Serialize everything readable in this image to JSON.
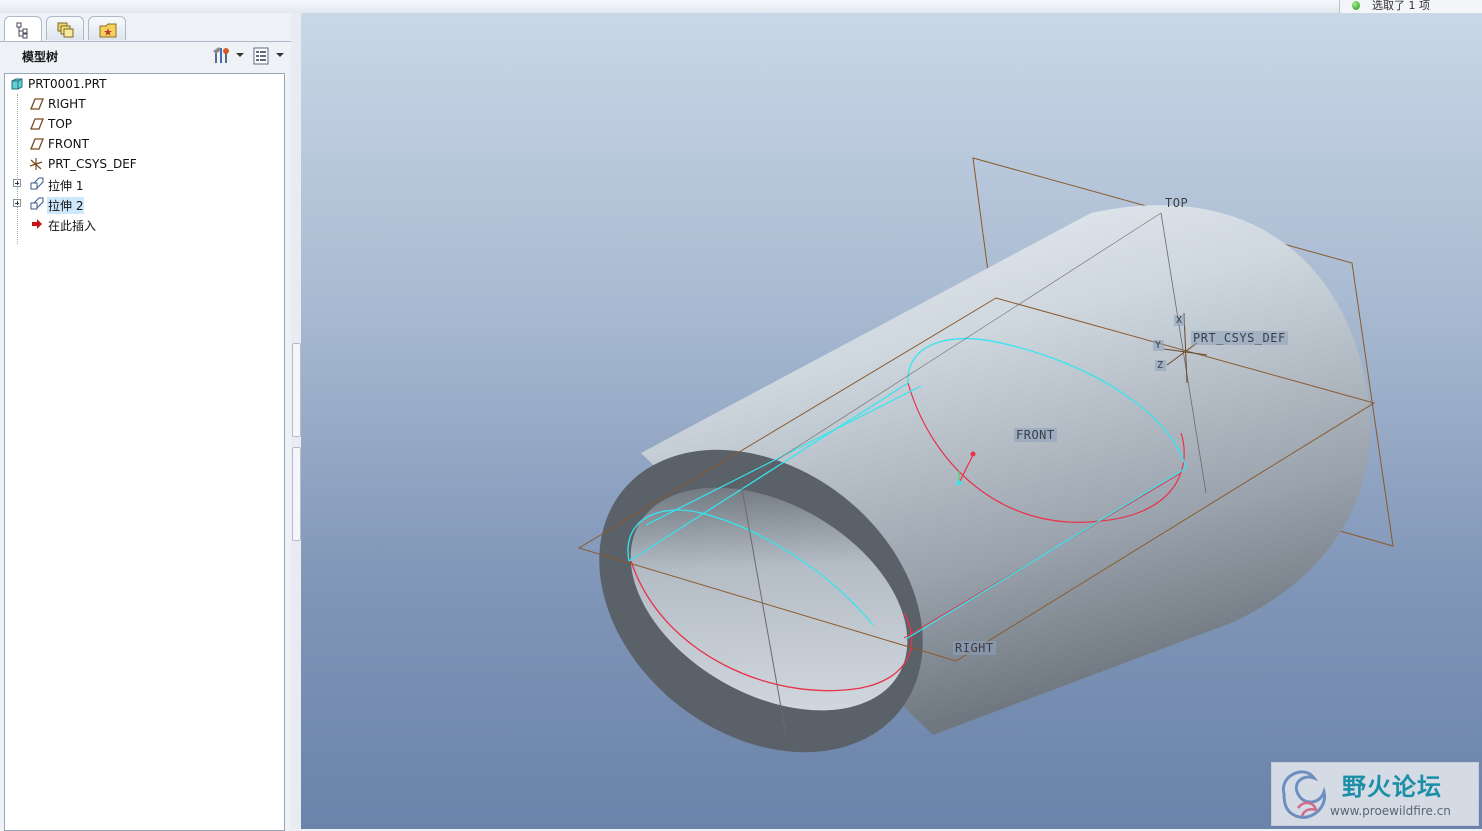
{
  "status": {
    "text": "选取了 1 项"
  },
  "left_panel": {
    "tabs": [
      {
        "name": "model-tree-tab",
        "icon": "tree-icon"
      },
      {
        "name": "layer-tab",
        "icon": "layers-icon"
      },
      {
        "name": "favorites-tab",
        "icon": "folder-star-icon"
      }
    ],
    "title": "模型树",
    "tools": [
      "tree-settings-icon",
      "tree-filter-icon"
    ]
  },
  "tree": [
    {
      "label": "PRT0001.PRT",
      "icon": "part-icon",
      "indent": 0
    },
    {
      "label": "RIGHT",
      "icon": "datum-plane-icon",
      "indent": 1
    },
    {
      "label": "TOP",
      "icon": "datum-plane-icon",
      "indent": 1
    },
    {
      "label": "FRONT",
      "icon": "datum-plane-icon",
      "indent": 1
    },
    {
      "label": "PRT_CSYS_DEF",
      "icon": "csys-icon",
      "indent": 1
    },
    {
      "label": "拉伸 1",
      "icon": "extrude-icon",
      "indent": 1,
      "expandable": true
    },
    {
      "label": "拉伸 2",
      "icon": "extrude-icon",
      "indent": 1,
      "expandable": true,
      "selected": true
    },
    {
      "label": "在此插入",
      "icon": "insert-arrow-icon",
      "indent": 1
    }
  ],
  "viewport": {
    "plane_labels": {
      "top": "TOP",
      "front": "FRONT",
      "right": "RIGHT"
    },
    "csys_label": "PRT_CSYS_DEF",
    "axis_labels": {
      "x": "X",
      "y": "Y",
      "z": "Z"
    },
    "colors": {
      "edge_cyan": "#35e6f0",
      "edge_red": "#e8334a",
      "datum_brown": "#8a5a2b"
    }
  },
  "watermark": {
    "title": "野火论坛",
    "url": "www.proewildfire.cn"
  }
}
